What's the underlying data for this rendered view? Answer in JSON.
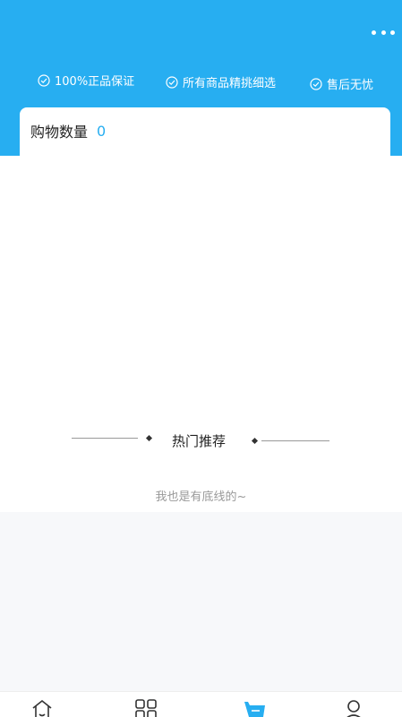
{
  "header": {
    "more_icon": "more-dots-icon",
    "guarantees": [
      {
        "icon": "check-circle-icon",
        "label": "100%正品保证"
      },
      {
        "icon": "check-circle-icon",
        "label": "所有商品精挑细选"
      },
      {
        "icon": "check-circle-icon",
        "label": "售后无忧"
      }
    ]
  },
  "cart": {
    "count_label": "购物数量",
    "count_value": "0"
  },
  "recommend": {
    "title": "热门推荐",
    "bottom_text": "我也是有底线的~"
  },
  "tabbar": {
    "items": [
      {
        "icon": "home-icon"
      },
      {
        "icon": "category-grid-icon"
      },
      {
        "icon": "cart-icon",
        "active": true
      },
      {
        "icon": "profile-icon"
      }
    ]
  },
  "colors": {
    "primary": "#27aef1",
    "background": "#ffffff",
    "gray_area": "#f7f8fa",
    "text_muted": "#999999"
  }
}
